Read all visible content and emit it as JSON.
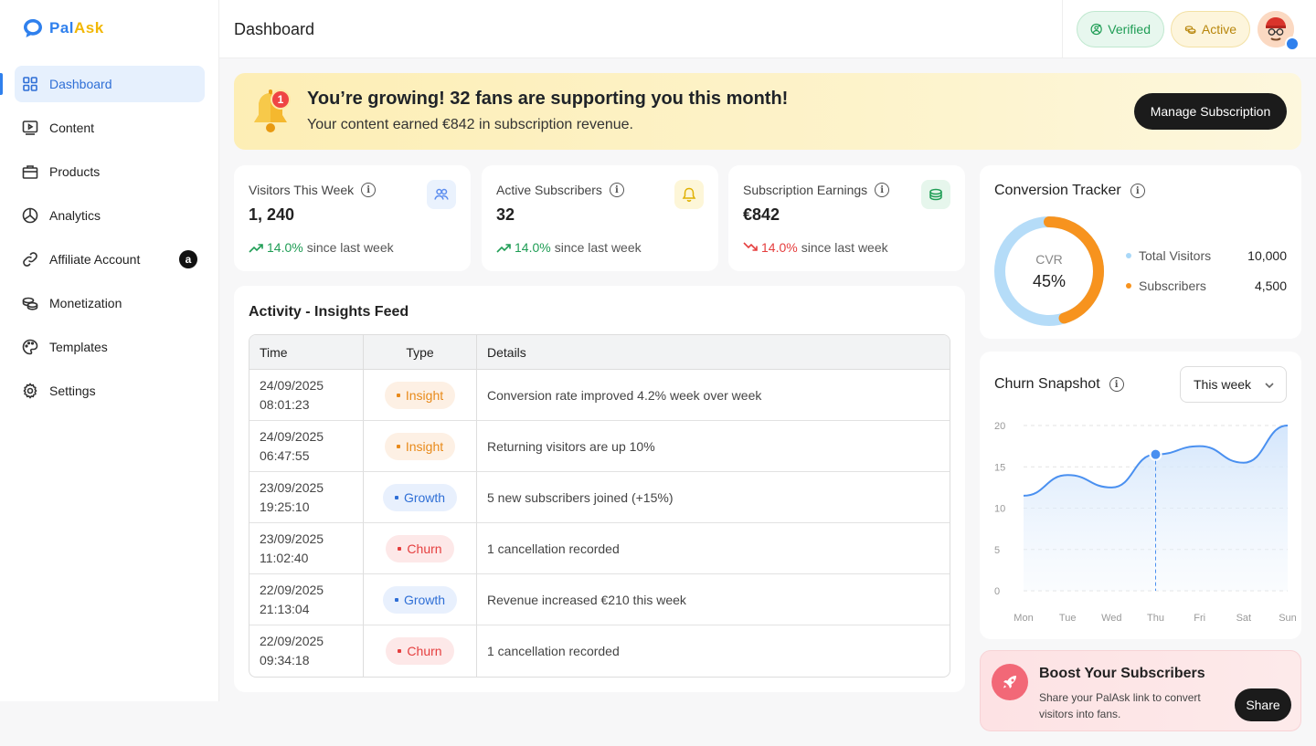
{
  "app": {
    "name_part1": "Pal",
    "name_part2": "Ask"
  },
  "sidebar": {
    "items": [
      {
        "label": "Dashboard",
        "icon": "grid-icon"
      },
      {
        "label": "Content",
        "icon": "play-screen-icon"
      },
      {
        "label": "Products",
        "icon": "bag-icon"
      },
      {
        "label": "Analytics",
        "icon": "pie-chart-icon"
      },
      {
        "label": "Affiliate Account",
        "icon": "link-icon",
        "badge": "a"
      },
      {
        "label": "Monetization",
        "icon": "coins-icon"
      },
      {
        "label": "Templates",
        "icon": "palette-icon"
      },
      {
        "label": "Settings",
        "icon": "gear-icon"
      }
    ]
  },
  "header": {
    "title": "Dashboard",
    "verified_label": "Verified",
    "active_label": "Active"
  },
  "banner": {
    "notification_count": "1",
    "title": "You’re growing! 32 fans are supporting you this month!",
    "subtitle": "Your content earned €842 in subscription revenue.",
    "button_label": "Manage Subscription"
  },
  "stats": [
    {
      "label": "Visitors This Week",
      "value": "1, 240",
      "trend": "14.0%",
      "trend_direction": "up",
      "trend_suffix": "since last week",
      "icon": "users-icon",
      "icon_color": "#5b8def",
      "icon_bg": "#eaf2fd"
    },
    {
      "label": "Active Subscribers",
      "value": "32",
      "trend": "14.0%",
      "trend_direction": "up",
      "trend_suffix": "since last week",
      "icon": "bell-icon",
      "icon_color": "#e0b000",
      "icon_bg": "#fdf6d8"
    },
    {
      "label": "Subscription Earnings",
      "value": "€842",
      "trend": "14.0%",
      "trend_direction": "down",
      "trend_suffix": "since last week",
      "icon": "coins-icon",
      "icon_color": "#1f9d55",
      "icon_bg": "#e6f6ec"
    }
  ],
  "activity": {
    "title": "Activity - Insights Feed",
    "columns": [
      "Time",
      "Type",
      "Details"
    ],
    "rows": [
      {
        "date": "24/09/2025",
        "time": "08:01:23",
        "type": "Insight",
        "details": "Conversion rate improved 4.2% week over week"
      },
      {
        "date": "24/09/2025",
        "time": "06:47:55",
        "type": "Insight",
        "details": "Returning visitors are up 10%"
      },
      {
        "date": "23/09/2025",
        "time": "19:25:10",
        "type": "Growth",
        "details": "5 new subscribers joined (+15%)"
      },
      {
        "date": "23/09/2025",
        "time": "11:02:40",
        "type": "Churn",
        "details": "1 cancellation recorded"
      },
      {
        "date": "22/09/2025",
        "time": "21:13:04",
        "type": "Growth",
        "details": "Revenue increased €210 this week"
      },
      {
        "date": "22/09/2025",
        "time": "09:34:18",
        "type": "Churn",
        "details": "1 cancellation recorded"
      }
    ]
  },
  "conversion": {
    "title": "Conversion Tracker",
    "center_label": "CVR",
    "center_value": "45%",
    "percent": 45,
    "legend": [
      {
        "label": "Total Visitors",
        "value": "10,000",
        "color": "#a9d8f8"
      },
      {
        "label": "Subscribers",
        "value": "4,500",
        "color": "#f7931e"
      }
    ]
  },
  "churn": {
    "title": "Churn Snapshot",
    "period": "This week",
    "chart_data": {
      "type": "area",
      "x": [
        "Mon",
        "Tue",
        "Wed",
        "Thu",
        "Fri",
        "Sat",
        "Sun"
      ],
      "values": [
        11.5,
        14,
        12.5,
        16.5,
        17.5,
        15.5,
        20
      ],
      "ylim": [
        0,
        20
      ],
      "yticks": [
        0,
        5,
        10,
        15,
        20
      ],
      "highlight_x": "Thu",
      "highlight_value": 16.5,
      "grid": true,
      "line_color": "#4a90f0"
    }
  },
  "boost": {
    "title": "Boost Your Subscribers",
    "text": "Share your PalAsk link to convert visitors into fans.",
    "button_label": "Share"
  }
}
